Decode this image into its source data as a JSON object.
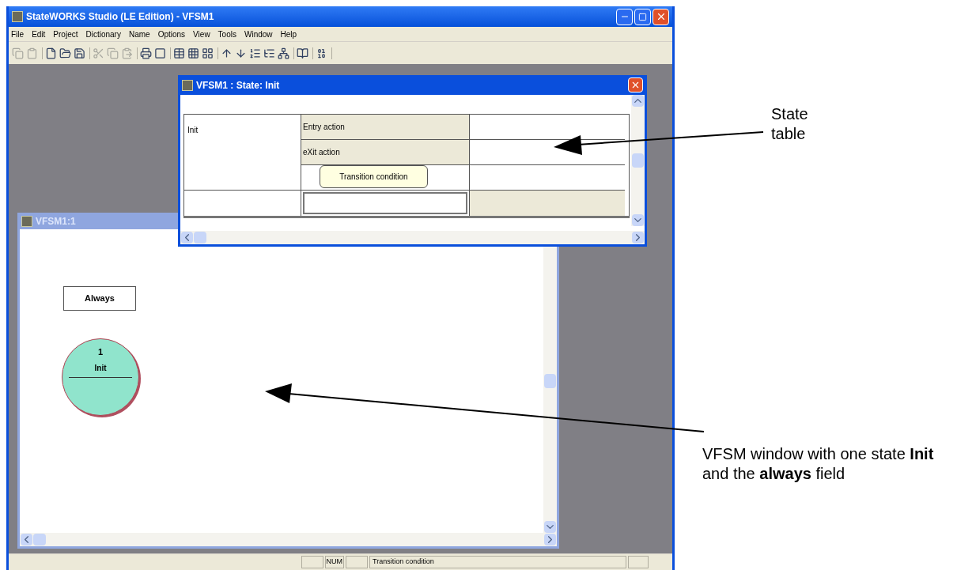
{
  "app_window": {
    "title": "StateWORKS Studio (LE Edition) - VFSM1",
    "menu": [
      "File",
      "Edit",
      "Project",
      "Dictionary",
      "Name",
      "Options",
      "View",
      "Tools",
      "Window",
      "Help"
    ],
    "status_bar": {
      "num_indicator": "NUM",
      "message": "Transition condition"
    }
  },
  "state_window": {
    "title": "VFSM1 : State: Init",
    "state_name": "Init",
    "action_rows": [
      {
        "label": "Entry action"
      },
      {
        "label": "eXit action"
      }
    ],
    "tooltip": "Transition condition"
  },
  "diagram_window": {
    "title": "VFSM1:1",
    "always_field": "Always",
    "states": [
      {
        "number": "1",
        "name": "Init"
      }
    ]
  },
  "annotations": [
    {
      "text": "State table"
    },
    {
      "text": "VFSM window with one state **Init** and the **always** field"
    }
  ]
}
